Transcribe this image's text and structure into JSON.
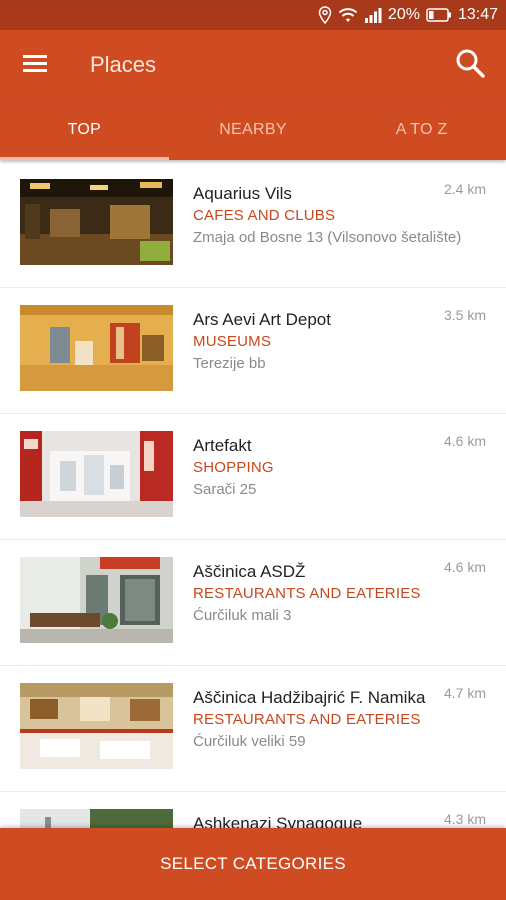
{
  "status_bar": {
    "battery": "20%",
    "time": "13:47",
    "icons": [
      "location-icon",
      "wifi-icon",
      "signal-icon",
      "battery-icon"
    ]
  },
  "app_bar": {
    "title": "Places",
    "menu_icon": "menu-icon",
    "search_icon": "search-icon"
  },
  "tabs": [
    {
      "label": "TOP",
      "active": true
    },
    {
      "label": "NEARBY",
      "active": false
    },
    {
      "label": "A TO Z",
      "active": false
    }
  ],
  "places": [
    {
      "name": "Aquarius Vils",
      "category": "CAFES AND CLUBS",
      "address": "Zmaja od Bosne 13 (Vilsonovo šetalište)",
      "distance": "2.4 km"
    },
    {
      "name": "Ars Aevi Art Depot",
      "category": "MUSEUMS",
      "address": "Terezije bb",
      "distance": "3.5 km"
    },
    {
      "name": "Artefakt",
      "category": "SHOPPING",
      "address": "Sarači 25",
      "distance": "4.6 km"
    },
    {
      "name": "Aščinica ASDŽ",
      "category": "RESTAURANTS AND EATERIES",
      "address": "Ćurčiluk mali 3",
      "distance": "4.6 km"
    },
    {
      "name": "Aščinica Hadžibajrić F. Namika",
      "category": "RESTAURANTS AND EATERIES",
      "address": "Ćurčiluk veliki  59",
      "distance": "4.7 km"
    },
    {
      "name": "Ashkenazi Synagogue",
      "category": "",
      "address": "",
      "distance": "4.3 km"
    }
  ],
  "bottom_button": {
    "label": "SELECT CATEGORIES"
  },
  "colors": {
    "status_bar": "#a8391a",
    "primary": "#cf4b22",
    "category_text": "#c9471c"
  }
}
